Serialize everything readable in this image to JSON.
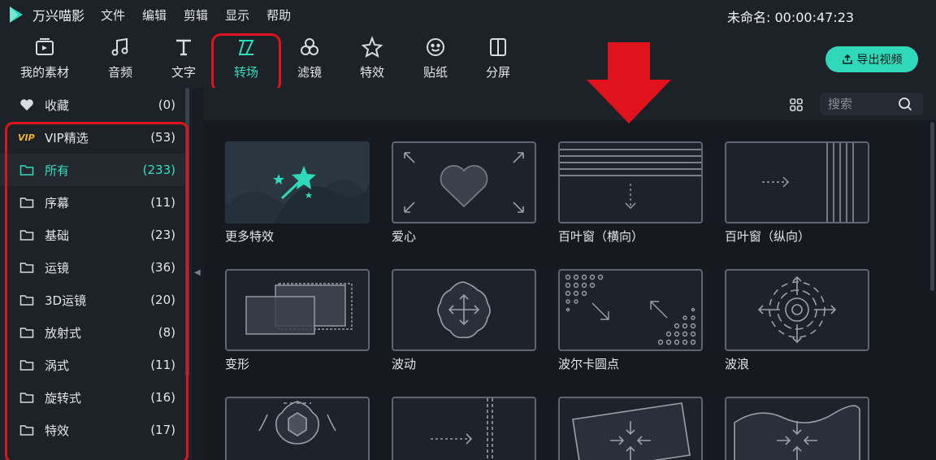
{
  "app": {
    "title": "万兴喵影",
    "menu": [
      "文件",
      "编辑",
      "剪辑",
      "显示",
      "帮助"
    ],
    "project_time": "未命名: 00:00:47:23"
  },
  "toolbar": {
    "tabs": [
      {
        "label": "我的素材",
        "icon": "folder-media-icon"
      },
      {
        "label": "音频",
        "icon": "music-note-icon"
      },
      {
        "label": "文字",
        "icon": "text-t-icon"
      },
      {
        "label": "转场",
        "icon": "transition-icon",
        "active": true
      },
      {
        "label": "滤镜",
        "icon": "filter-icon"
      },
      {
        "label": "特效",
        "icon": "effects-star-icon"
      },
      {
        "label": "贴纸",
        "icon": "sticker-smile-icon"
      },
      {
        "label": "分屏",
        "icon": "split-screen-icon"
      }
    ],
    "export_label": "导出视频"
  },
  "sidebar": {
    "items": [
      {
        "label": "收藏",
        "count": "(0)",
        "icon": "heart-icon"
      },
      {
        "label": "VIP精选",
        "count": "(53)",
        "icon": "vip-badge",
        "badge": "VIP"
      },
      {
        "label": "所有",
        "count": "(233)",
        "icon": "folder-icon",
        "selected": true
      },
      {
        "label": "序幕",
        "count": "(11)",
        "icon": "folder-icon"
      },
      {
        "label": "基础",
        "count": "(23)",
        "icon": "folder-icon"
      },
      {
        "label": "运镜",
        "count": "(36)",
        "icon": "folder-icon"
      },
      {
        "label": "3D运镜",
        "count": "(20)",
        "icon": "folder-icon"
      },
      {
        "label": "放射式",
        "count": "(8)",
        "icon": "folder-icon"
      },
      {
        "label": "涡式",
        "count": "(11)",
        "icon": "folder-icon"
      },
      {
        "label": "旋转式",
        "count": "(16)",
        "icon": "folder-icon"
      },
      {
        "label": "特效",
        "count": "(17)",
        "icon": "folder-icon"
      }
    ]
  },
  "search": {
    "placeholder": "搜索"
  },
  "transitions": [
    {
      "label": "更多特效"
    },
    {
      "label": "爱心"
    },
    {
      "label": "百叶窗（横向）"
    },
    {
      "label": "百叶窗（纵向）"
    },
    {
      "label": "变形"
    },
    {
      "label": "波动"
    },
    {
      "label": "波尔卡圆点"
    },
    {
      "label": "波浪"
    },
    {
      "label": ""
    },
    {
      "label": ""
    },
    {
      "label": ""
    },
    {
      "label": ""
    }
  ],
  "colors": {
    "accent": "#2fe0bd",
    "highlight_red": "#e0121c",
    "background": "#16191f",
    "panel": "#1d2128"
  }
}
